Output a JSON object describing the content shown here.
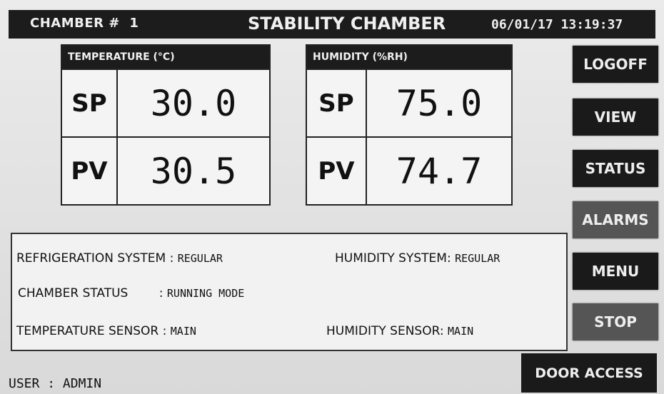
{
  "header": {
    "chamber_label": "CHAMBER #",
    "chamber_number": "1",
    "title": "STABILITY CHAMBER",
    "date": "06/01/17",
    "time": "13:19:37"
  },
  "temperature": {
    "title": "TEMPERATURE (°C)",
    "sp_label": "SP",
    "sp_value": "30.0",
    "pv_label": "PV",
    "pv_value": "30.5"
  },
  "humidity": {
    "title": "HUMIDITY (%RH)",
    "sp_label": "SP",
    "sp_value": "75.0",
    "pv_label": "PV",
    "pv_value": "74.7"
  },
  "buttons": {
    "logoff": "LOGOFF",
    "view": "VIEW",
    "status": "STATUS",
    "alarms": "ALARMS",
    "menu": "MENU",
    "stop": "STOP",
    "door_access": "DOOR ACCESS"
  },
  "status": {
    "refrigeration_label": "REFRIGERATION SYSTEM :",
    "refrigeration_value": "REGULAR",
    "humidity_system_label": "HUMIDITY SYSTEM:",
    "humidity_system_value": "REGULAR",
    "chamber_status_label": "CHAMBER STATUS",
    "chamber_status_sep": ":",
    "chamber_status_value": "RUNNING MODE",
    "temp_sensor_label": "TEMPERATURE SENSOR :",
    "temp_sensor_value": "MAIN",
    "hum_sensor_label": "HUMIDITY SENSOR:",
    "hum_sensor_value": "MAIN"
  },
  "user": {
    "label": "USER",
    "sep": ":",
    "name": "ADMIN"
  },
  "colors": {
    "bar_dark": "#1c1c1c",
    "button_dark": "#1a1a1a",
    "button_grey": "#555555",
    "background": "#e4e4e4"
  }
}
